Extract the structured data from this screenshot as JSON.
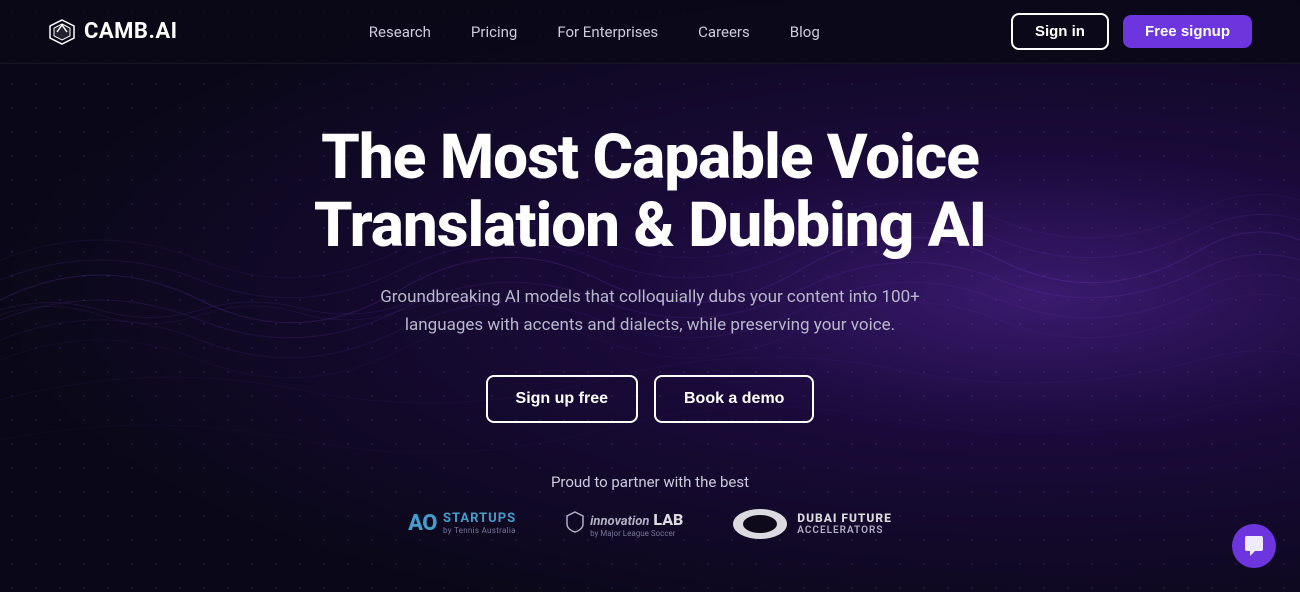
{
  "brand": {
    "logo_text": "CAMB.AI"
  },
  "navbar": {
    "links": [
      {
        "label": "Research",
        "id": "research"
      },
      {
        "label": "Pricing",
        "id": "pricing"
      },
      {
        "label": "For Enterprises",
        "id": "enterprises"
      },
      {
        "label": "Careers",
        "id": "careers"
      },
      {
        "label": "Blog",
        "id": "blog"
      }
    ],
    "signin_label": "Sign in",
    "signup_label": "Free signup"
  },
  "hero": {
    "title_line1": "The Most Capable Voice",
    "title_line2": "Translation & Dubbing AI",
    "subtitle": "Groundbreaking AI models that colloquially dubs your content into 100+ languages with accents and dialects, while preserving your voice.",
    "cta_primary": "Sign up free",
    "cta_secondary": "Book a demo"
  },
  "partners": {
    "label": "Proud to partner with the best",
    "logos": [
      {
        "name": "AO Startups",
        "id": "ao"
      },
      {
        "name": "innovation LAB",
        "id": "innovation"
      },
      {
        "name": "Dubai Future Accelerators",
        "id": "dubai"
      }
    ]
  }
}
